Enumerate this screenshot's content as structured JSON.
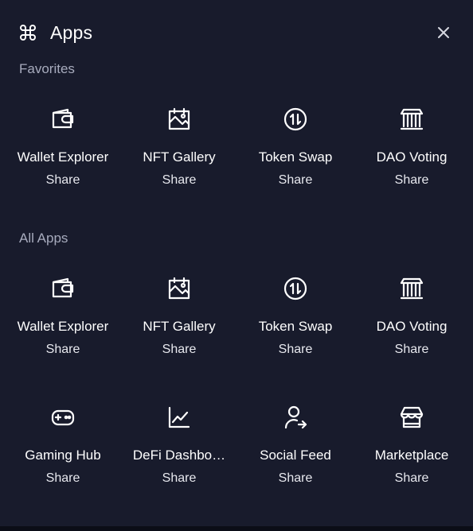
{
  "header": {
    "title": "Apps",
    "icon": "command-icon",
    "close_icon": "close-icon"
  },
  "sections": {
    "favorites": {
      "label": "Favorites",
      "items": [
        {
          "name": "Wallet Explorer",
          "action": "Share",
          "icon": "wallet-icon"
        },
        {
          "name": "NFT Gallery",
          "action": "Share",
          "icon": "image-gallery-icon"
        },
        {
          "name": "Token Swap",
          "action": "Share",
          "icon": "swap-icon"
        },
        {
          "name": "DAO Voting",
          "action": "Share",
          "icon": "bank-icon"
        }
      ]
    },
    "all_apps": {
      "label": "All Apps",
      "items": [
        {
          "name": "Wallet Explorer",
          "action": "Share",
          "icon": "wallet-icon"
        },
        {
          "name": "NFT Gallery",
          "action": "Share",
          "icon": "image-gallery-icon"
        },
        {
          "name": "Token Swap",
          "action": "Share",
          "icon": "swap-icon"
        },
        {
          "name": "DAO Voting",
          "action": "Share",
          "icon": "bank-icon"
        },
        {
          "name": "Gaming Hub",
          "action": "Share",
          "icon": "gamepad-icon"
        },
        {
          "name": "DeFi Dashbo…",
          "action": "Share",
          "icon": "line-chart-icon"
        },
        {
          "name": "Social Feed",
          "action": "Share",
          "icon": "user-share-icon"
        },
        {
          "name": "Marketplace",
          "action": "Share",
          "icon": "store-icon"
        }
      ]
    }
  },
  "colors": {
    "panel_bg": "#181b2c",
    "page_bg": "#0b0d17",
    "text": "#ffffff",
    "muted": "#a7abbd"
  }
}
